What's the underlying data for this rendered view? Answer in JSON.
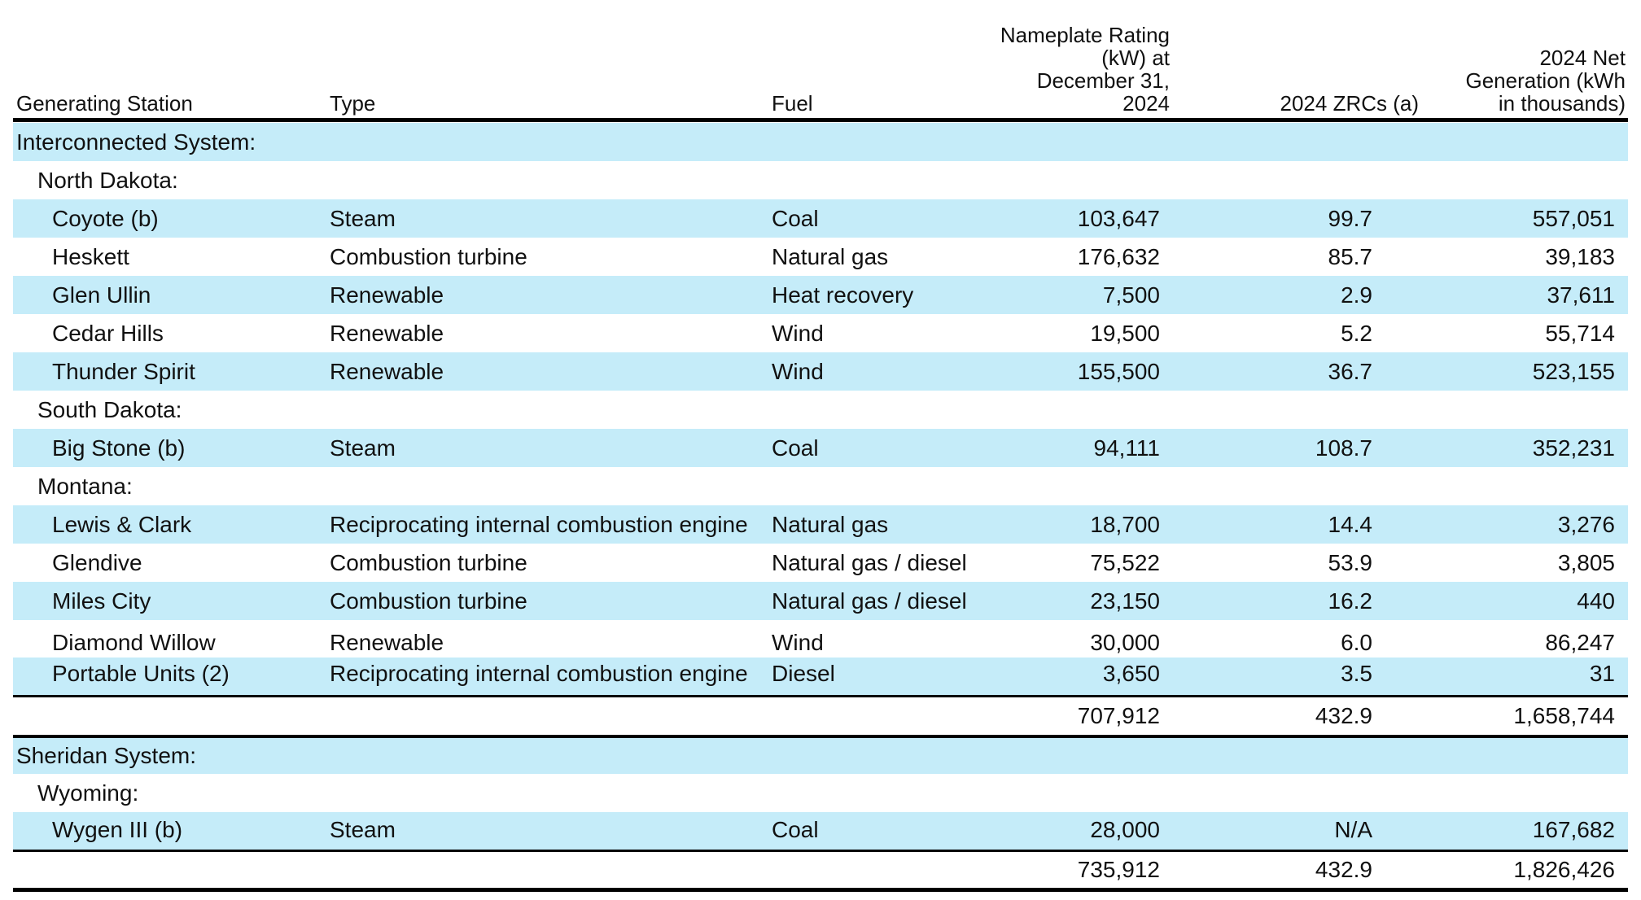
{
  "headers": {
    "station": "Generating Station",
    "type": "Type",
    "fuel": "Fuel",
    "kw_1": "Nameplate Rating",
    "kw_2": "(kW) at",
    "kw_3": "December 31,",
    "kw_4": "2024",
    "zrc": "2024 ZRCs (a)",
    "gen_1": "2024 Net",
    "gen_2": "Generation (kWh",
    "gen_3": "in thousands)"
  },
  "interconnected": {
    "label": "Interconnected System:",
    "nd_label": "North Dakota:",
    "sd_label": "South Dakota:",
    "mt_label": "Montana:",
    "rows": [
      {
        "station": "Coyote (b)",
        "type": "Steam",
        "fuel": "Coal",
        "kw": "103,647",
        "zrc": "99.7",
        "gen": "557,051"
      },
      {
        "station": "Heskett",
        "type": "Combustion turbine",
        "fuel": "Natural gas",
        "kw": "176,632",
        "zrc": "85.7",
        "gen": "39,183"
      },
      {
        "station": "Glen Ullin",
        "type": "Renewable",
        "fuel": "Heat recovery",
        "kw": "7,500",
        "zrc": "2.9",
        "gen": "37,611"
      },
      {
        "station": "Cedar Hills",
        "type": "Renewable",
        "fuel": "Wind",
        "kw": "19,500",
        "zrc": "5.2",
        "gen": "55,714"
      },
      {
        "station": "Thunder Spirit",
        "type": "Renewable",
        "fuel": "Wind",
        "kw": "155,500",
        "zrc": "36.7",
        "gen": "523,155"
      },
      {
        "station": "Big Stone (b)",
        "type": "Steam",
        "fuel": "Coal",
        "kw": "94,111",
        "zrc": "108.7",
        "gen": "352,231"
      },
      {
        "station": "Lewis & Clark",
        "type": "Reciprocating internal combustion engine",
        "fuel": "Natural gas",
        "kw": "18,700",
        "zrc": "14.4",
        "gen": "3,276"
      },
      {
        "station": "Glendive",
        "type": "Combustion turbine",
        "fuel": "Natural gas / diesel",
        "kw": "75,522",
        "zrc": "53.9",
        "gen": "3,805"
      },
      {
        "station": "Miles City",
        "type": "Combustion turbine",
        "fuel": "Natural gas / diesel",
        "kw": "23,150",
        "zrc": "16.2",
        "gen": "440"
      },
      {
        "station": "Diamond Willow",
        "type": "Renewable",
        "fuel": "Wind",
        "kw": "30,000",
        "zrc": "6.0",
        "gen": "86,247"
      },
      {
        "station": "Portable Units (2)",
        "type": "Reciprocating internal combustion engine",
        "fuel": "Diesel",
        "kw": "3,650",
        "zrc": "3.5",
        "gen": "31"
      }
    ],
    "subtotal": {
      "kw": "707,912",
      "zrc": "432.9",
      "gen": "1,658,744"
    }
  },
  "sheridan": {
    "label": "Sheridan System:",
    "wy_label": "Wyoming:",
    "rows": [
      {
        "station": "Wygen III (b)",
        "type": "Steam",
        "fuel": "Coal",
        "kw": "28,000",
        "zrc": "N/A",
        "gen": "167,682"
      }
    ]
  },
  "total": {
    "kw": "735,912",
    "zrc": "432.9",
    "gen": "1,826,426"
  },
  "colors": {
    "row_shade": "#c5ecf9",
    "rule": "#000000"
  }
}
